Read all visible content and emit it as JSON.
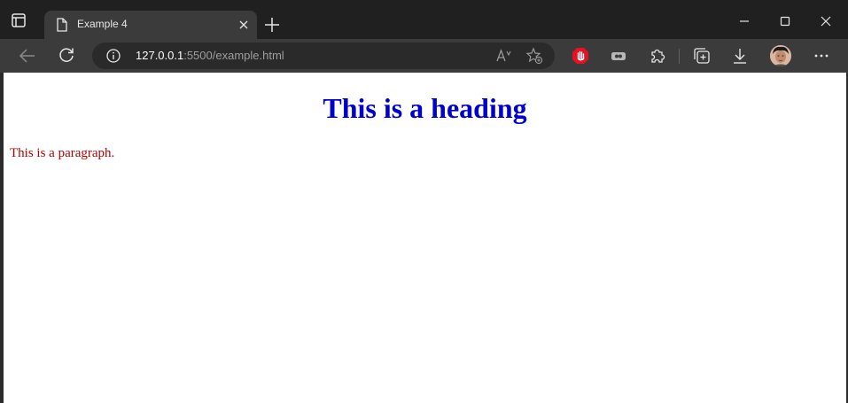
{
  "browser": {
    "tab": {
      "title": "Example 4"
    },
    "address_bar": {
      "url_host": "127.0.0.1",
      "url_rest": ":5500/example.html"
    }
  },
  "page": {
    "heading": "This is a heading",
    "paragraph": "This is a paragraph."
  },
  "colors": {
    "heading": "#0000cc",
    "paragraph": "#b30000",
    "adblock_badge": "#e81123"
  },
  "icons": [
    "tab-actions-icon",
    "page-icon",
    "close-icon",
    "plus-icon",
    "minimize-icon",
    "maximize-icon",
    "window-close-icon",
    "back-arrow-icon",
    "refresh-icon",
    "info-icon",
    "read-aloud-icon",
    "favorite-add-icon",
    "adblock-icon",
    "extension-badge-icon",
    "puzzle-icon",
    "collections-icon",
    "download-icon",
    "more-icon"
  ]
}
